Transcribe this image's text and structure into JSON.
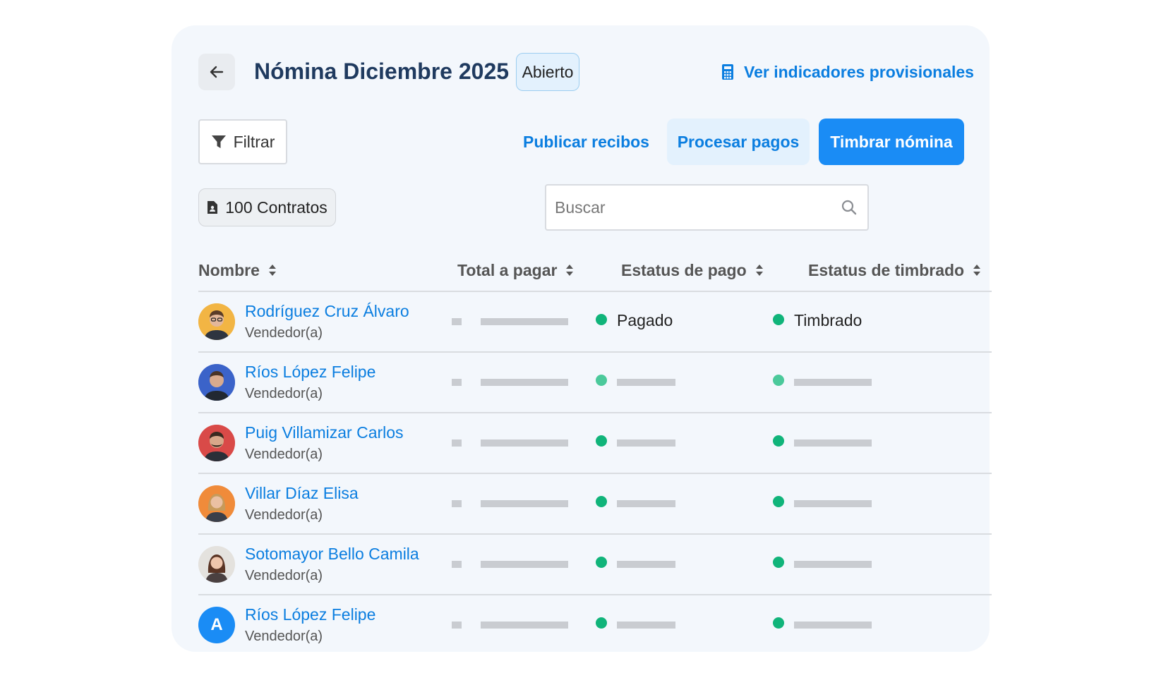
{
  "header": {
    "title": "Nómina Diciembre 2025",
    "status_badge": "Abierto",
    "indicators_link": "Ver indicadores provisionales"
  },
  "toolbar": {
    "filter_label": "Filtrar",
    "publish_label": "Publicar recibos",
    "process_label": "Procesar pagos",
    "stamp_label": "Timbrar nómina"
  },
  "contracts": {
    "label": "100 Contratos"
  },
  "search": {
    "placeholder": "Buscar"
  },
  "table": {
    "columns": [
      "Nombre",
      "Total a pagar",
      "Estatus de pago",
      "Estatus de timbrado"
    ],
    "rows": [
      {
        "name": "Rodríguez Cruz Álvaro",
        "role": "Vendedor(a)",
        "pay_status": "Pagado",
        "stamp_status": "Timbrado"
      },
      {
        "name": "Ríos López Felipe",
        "role": "Vendedor(a)",
        "pay_status": "",
        "stamp_status": ""
      },
      {
        "name": "Puig Villamizar Carlos",
        "role": "Vendedor(a)",
        "pay_status": "",
        "stamp_status": ""
      },
      {
        "name": "Villar Díaz Elisa",
        "role": "Vendedor(a)",
        "pay_status": "",
        "stamp_status": ""
      },
      {
        "name": "Sotomayor Bello Camila",
        "role": "Vendedor(a)",
        "pay_status": "",
        "stamp_status": ""
      },
      {
        "name": "Ríos López Felipe",
        "role": "Vendedor(a)",
        "pay_status": "",
        "stamp_status": "",
        "avatar_initial": "A"
      }
    ]
  },
  "colors": {
    "accent": "#1a8cf5",
    "link": "#0b7ee0",
    "title": "#1f3a5f",
    "status_green": "#10b47a"
  }
}
